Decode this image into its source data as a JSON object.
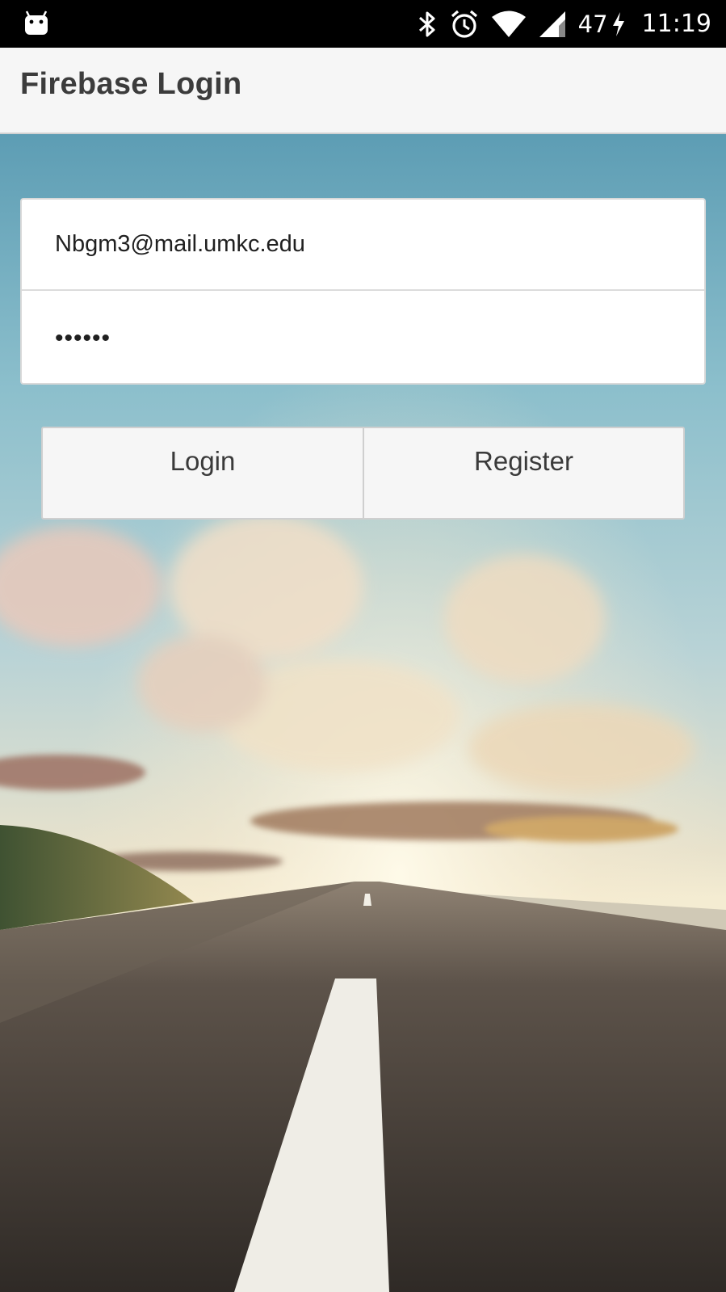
{
  "status_bar": {
    "left_icon": "android-notification-icon",
    "icons": [
      "bluetooth-icon",
      "alarm-icon",
      "wifi-icon",
      "cell-signal-icon",
      "battery-charging-icon"
    ],
    "battery_level": "47",
    "time": "11:19"
  },
  "app_bar": {
    "title": "Firebase Login"
  },
  "form": {
    "email": {
      "value": "Nbgm3@mail.umkc.edu",
      "placeholder": ""
    },
    "password": {
      "value": "••••••",
      "placeholder": ""
    }
  },
  "buttons": {
    "login_label": "Login",
    "register_label": "Register"
  },
  "background": {
    "description_icon": "road-landscape-image"
  },
  "colors": {
    "status_bar": "#000000",
    "app_bar": "#f6f6f6",
    "title_text": "#3c3c3c",
    "button_bg": "#f6f6f6",
    "sky_top": "#5f9fb6",
    "road": "#3e3832"
  }
}
